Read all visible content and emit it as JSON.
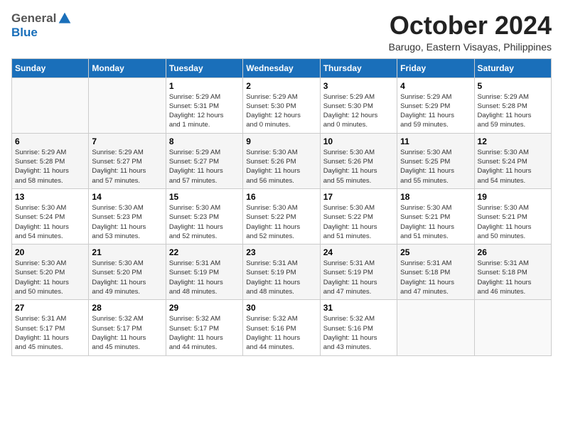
{
  "logo": {
    "general": "General",
    "blue": "Blue"
  },
  "title": "October 2024",
  "subtitle": "Barugo, Eastern Visayas, Philippines",
  "days_header": [
    "Sunday",
    "Monday",
    "Tuesday",
    "Wednesday",
    "Thursday",
    "Friday",
    "Saturday"
  ],
  "weeks": [
    [
      {
        "day": "",
        "detail": ""
      },
      {
        "day": "",
        "detail": ""
      },
      {
        "day": "1",
        "detail": "Sunrise: 5:29 AM\nSunset: 5:31 PM\nDaylight: 12 hours\nand 1 minute."
      },
      {
        "day": "2",
        "detail": "Sunrise: 5:29 AM\nSunset: 5:30 PM\nDaylight: 12 hours\nand 0 minutes."
      },
      {
        "day": "3",
        "detail": "Sunrise: 5:29 AM\nSunset: 5:30 PM\nDaylight: 12 hours\nand 0 minutes."
      },
      {
        "day": "4",
        "detail": "Sunrise: 5:29 AM\nSunset: 5:29 PM\nDaylight: 11 hours\nand 59 minutes."
      },
      {
        "day": "5",
        "detail": "Sunrise: 5:29 AM\nSunset: 5:28 PM\nDaylight: 11 hours\nand 59 minutes."
      }
    ],
    [
      {
        "day": "6",
        "detail": "Sunrise: 5:29 AM\nSunset: 5:28 PM\nDaylight: 11 hours\nand 58 minutes."
      },
      {
        "day": "7",
        "detail": "Sunrise: 5:29 AM\nSunset: 5:27 PM\nDaylight: 11 hours\nand 57 minutes."
      },
      {
        "day": "8",
        "detail": "Sunrise: 5:29 AM\nSunset: 5:27 PM\nDaylight: 11 hours\nand 57 minutes."
      },
      {
        "day": "9",
        "detail": "Sunrise: 5:30 AM\nSunset: 5:26 PM\nDaylight: 11 hours\nand 56 minutes."
      },
      {
        "day": "10",
        "detail": "Sunrise: 5:30 AM\nSunset: 5:26 PM\nDaylight: 11 hours\nand 55 minutes."
      },
      {
        "day": "11",
        "detail": "Sunrise: 5:30 AM\nSunset: 5:25 PM\nDaylight: 11 hours\nand 55 minutes."
      },
      {
        "day": "12",
        "detail": "Sunrise: 5:30 AM\nSunset: 5:24 PM\nDaylight: 11 hours\nand 54 minutes."
      }
    ],
    [
      {
        "day": "13",
        "detail": "Sunrise: 5:30 AM\nSunset: 5:24 PM\nDaylight: 11 hours\nand 54 minutes."
      },
      {
        "day": "14",
        "detail": "Sunrise: 5:30 AM\nSunset: 5:23 PM\nDaylight: 11 hours\nand 53 minutes."
      },
      {
        "day": "15",
        "detail": "Sunrise: 5:30 AM\nSunset: 5:23 PM\nDaylight: 11 hours\nand 52 minutes."
      },
      {
        "day": "16",
        "detail": "Sunrise: 5:30 AM\nSunset: 5:22 PM\nDaylight: 11 hours\nand 52 minutes."
      },
      {
        "day": "17",
        "detail": "Sunrise: 5:30 AM\nSunset: 5:22 PM\nDaylight: 11 hours\nand 51 minutes."
      },
      {
        "day": "18",
        "detail": "Sunrise: 5:30 AM\nSunset: 5:21 PM\nDaylight: 11 hours\nand 51 minutes."
      },
      {
        "day": "19",
        "detail": "Sunrise: 5:30 AM\nSunset: 5:21 PM\nDaylight: 11 hours\nand 50 minutes."
      }
    ],
    [
      {
        "day": "20",
        "detail": "Sunrise: 5:30 AM\nSunset: 5:20 PM\nDaylight: 11 hours\nand 50 minutes."
      },
      {
        "day": "21",
        "detail": "Sunrise: 5:30 AM\nSunset: 5:20 PM\nDaylight: 11 hours\nand 49 minutes."
      },
      {
        "day": "22",
        "detail": "Sunrise: 5:31 AM\nSunset: 5:19 PM\nDaylight: 11 hours\nand 48 minutes."
      },
      {
        "day": "23",
        "detail": "Sunrise: 5:31 AM\nSunset: 5:19 PM\nDaylight: 11 hours\nand 48 minutes."
      },
      {
        "day": "24",
        "detail": "Sunrise: 5:31 AM\nSunset: 5:19 PM\nDaylight: 11 hours\nand 47 minutes."
      },
      {
        "day": "25",
        "detail": "Sunrise: 5:31 AM\nSunset: 5:18 PM\nDaylight: 11 hours\nand 47 minutes."
      },
      {
        "day": "26",
        "detail": "Sunrise: 5:31 AM\nSunset: 5:18 PM\nDaylight: 11 hours\nand 46 minutes."
      }
    ],
    [
      {
        "day": "27",
        "detail": "Sunrise: 5:31 AM\nSunset: 5:17 PM\nDaylight: 11 hours\nand 45 minutes."
      },
      {
        "day": "28",
        "detail": "Sunrise: 5:32 AM\nSunset: 5:17 PM\nDaylight: 11 hours\nand 45 minutes."
      },
      {
        "day": "29",
        "detail": "Sunrise: 5:32 AM\nSunset: 5:17 PM\nDaylight: 11 hours\nand 44 minutes."
      },
      {
        "day": "30",
        "detail": "Sunrise: 5:32 AM\nSunset: 5:16 PM\nDaylight: 11 hours\nand 44 minutes."
      },
      {
        "day": "31",
        "detail": "Sunrise: 5:32 AM\nSunset: 5:16 PM\nDaylight: 11 hours\nand 43 minutes."
      },
      {
        "day": "",
        "detail": ""
      },
      {
        "day": "",
        "detail": ""
      }
    ]
  ]
}
